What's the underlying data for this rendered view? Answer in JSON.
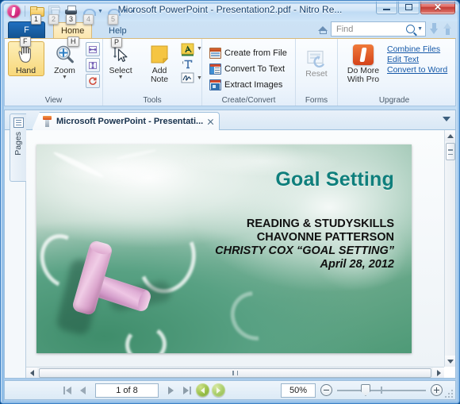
{
  "window": {
    "title": "Microsoft PowerPoint - Presentation2.pdf - Nitro Re...",
    "minimize_label": "Minimize",
    "maximize_label": "Maximize",
    "close_label": "Close"
  },
  "quick_access": {
    "items": [
      {
        "name": "nitro-orb",
        "icon": "nitro-orb",
        "keytip": ""
      },
      {
        "name": "open",
        "icon": "open-folder-icon",
        "keytip": "1"
      },
      {
        "name": "save",
        "icon": "save-icon",
        "keytip": "2",
        "disabled": true
      },
      {
        "name": "print",
        "icon": "print-icon",
        "keytip": "3"
      },
      {
        "name": "undo",
        "icon": "undo-icon",
        "keytip": "4",
        "disabled": true
      },
      {
        "name": "redo",
        "icon": "redo-icon",
        "keytip": "5",
        "disabled": true
      }
    ],
    "customize_label": "Customize Quick Access Toolbar"
  },
  "ribbon": {
    "file_tab": {
      "label": "F",
      "keytip": "F"
    },
    "tabs": [
      {
        "label": "Home",
        "keytip": "H",
        "active": true
      },
      {
        "label": "Help",
        "keytip": "P",
        "active": false
      }
    ],
    "find": {
      "placeholder": "Find",
      "search_icon": "magnifier-icon",
      "dropdown_icon": "caret-down-icon",
      "find_prev_icon": "find-previous-icon",
      "find_next_icon": "find-next-icon",
      "home_icon": "home-icon"
    },
    "groups": [
      {
        "name": "View",
        "label": "View",
        "buttons": [
          {
            "label": "Hand",
            "icon": "hand-icon",
            "selected": true
          },
          {
            "label": "Zoom",
            "icon": "zoom-icon",
            "has_dropdown": true
          }
        ],
        "small_buttons": [
          {
            "name": "fit-width",
            "icon": "fit-width-icon"
          },
          {
            "name": "fit-page",
            "icon": "fit-page-icon"
          },
          {
            "name": "rotate-view",
            "icon": "rotate-icon"
          }
        ]
      },
      {
        "name": "Tools",
        "label": "Tools",
        "buttons": [
          {
            "label": "Select",
            "icon": "select-cursor-icon",
            "has_dropdown": true
          },
          {
            "label": "Add\nNote",
            "label_line1": "Add",
            "label_line2": "Note",
            "icon": "sticky-note-icon"
          }
        ],
        "small_buttons": [
          {
            "name": "highlight-text",
            "icon": "highlight-a-icon",
            "has_dropdown": true
          },
          {
            "name": "typewriter",
            "icon": "typewriter-t-icon"
          },
          {
            "name": "signature",
            "icon": "signature-icon",
            "has_dropdown": true
          }
        ]
      },
      {
        "name": "Create/Convert",
        "label": "Create/Convert",
        "items": [
          {
            "label": "Create from File",
            "icon": "create-from-file-icon"
          },
          {
            "label": "Convert To Text",
            "icon": "convert-to-text-icon"
          },
          {
            "label": "Extract Images",
            "icon": "extract-images-icon"
          }
        ]
      },
      {
        "name": "Forms",
        "label": "Forms",
        "buttons": [
          {
            "label": "Reset",
            "icon": "reset-form-icon",
            "disabled": true
          }
        ]
      },
      {
        "name": "Upgrade",
        "label": "Upgrade",
        "promo": {
          "icon": "nitro-pro-icon",
          "label_line1": "Do More",
          "label_line2": "With Pro"
        },
        "links": [
          "Combine Files",
          "Edit Text",
          "Convert to Word"
        ]
      }
    ]
  },
  "sidebar": {
    "pages_tab": {
      "label": "Pages",
      "icon": "pages-panel-icon"
    }
  },
  "document_tabs": {
    "tabs": [
      {
        "label": "Microsoft PowerPoint - Presentati...",
        "icon": "powerpoint-file-icon",
        "close_icon": "close-icon",
        "active": true
      }
    ],
    "overflow_icon": "caret-down-icon"
  },
  "slide": {
    "title": "Goal Setting",
    "title_color": "#0f7f7c",
    "lines": [
      {
        "text": "READING & STUDYSKILLS",
        "italic": false
      },
      {
        "text": "CHAVONNE PATTERSON",
        "italic": false
      },
      {
        "text": "CHRISTY COX “GOAL SETTING”",
        "italic": true
      },
      {
        "text": "April 28, 2012",
        "italic": true
      }
    ],
    "background_description": "pink chalk sticks on green chalkboard"
  },
  "status_bar": {
    "first_page_icon": "first-page-icon",
    "previous_page_icon": "previous-page-icon",
    "page_indicator": "1 of 8",
    "next_page_icon": "next-page-icon",
    "last_page_icon": "last-page-icon",
    "back_icon": "navigate-back-icon",
    "forward_icon": "navigate-forward-icon",
    "zoom_value": "50%",
    "zoom_out_icon": "zoom-out-icon",
    "zoom_in_icon": "zoom-in-icon",
    "resize_grip_icon": "resize-grip-icon"
  },
  "scrollbars": {
    "vertical_up_icon": "scroll-up-icon",
    "vertical_down_icon": "scroll-down-icon",
    "horizontal_left_icon": "scroll-left-icon",
    "horizontal_right_icon": "scroll-right-icon"
  }
}
